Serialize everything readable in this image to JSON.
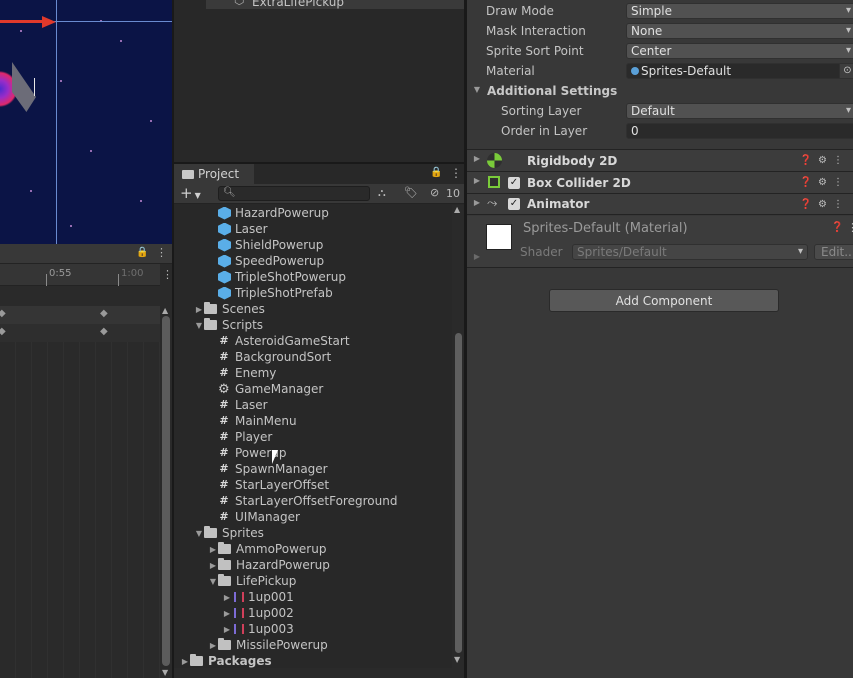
{
  "hierarchy": {
    "item": "ExtraLifePickup"
  },
  "animation": {
    "time_labels": [
      "0:55",
      "1:00"
    ]
  },
  "project": {
    "tab_title": "Project",
    "search": {
      "placeholder": ""
    },
    "hidden_count": "10",
    "items": [
      {
        "label": "HazardPowerup",
        "type": "prefab",
        "indent": 2
      },
      {
        "label": "Laser",
        "type": "prefab",
        "indent": 2
      },
      {
        "label": "ShieldPowerup",
        "type": "prefab",
        "indent": 2
      },
      {
        "label": "SpeedPowerup",
        "type": "prefab",
        "indent": 2
      },
      {
        "label": "TripleShotPowerup",
        "type": "prefab",
        "indent": 2
      },
      {
        "label": "TripleShotPrefab",
        "type": "prefab",
        "indent": 2
      },
      {
        "label": "Scenes",
        "type": "folder",
        "indent": 1,
        "arrow": "collapsed"
      },
      {
        "label": "Scripts",
        "type": "folder",
        "indent": 1,
        "arrow": "expanded"
      },
      {
        "label": "AsteroidGameStart",
        "type": "script",
        "indent": 2
      },
      {
        "label": "BackgroundSort",
        "type": "script",
        "indent": 2
      },
      {
        "label": "Enemy",
        "type": "script",
        "indent": 2
      },
      {
        "label": "GameManager",
        "type": "gear",
        "indent": 2
      },
      {
        "label": "Laser",
        "type": "script",
        "indent": 2
      },
      {
        "label": "MainMenu",
        "type": "script",
        "indent": 2
      },
      {
        "label": "Player",
        "type": "script",
        "indent": 2
      },
      {
        "label": "Powerup",
        "type": "script",
        "indent": 2
      },
      {
        "label": "SpawnManager",
        "type": "script",
        "indent": 2
      },
      {
        "label": "StarLayerOffset",
        "type": "script",
        "indent": 2
      },
      {
        "label": "StarLayerOffsetForeground",
        "type": "script",
        "indent": 2
      },
      {
        "label": "UIManager",
        "type": "script",
        "indent": 2
      },
      {
        "label": "Sprites",
        "type": "folder",
        "indent": 1,
        "arrow": "expanded"
      },
      {
        "label": "AmmoPowerup",
        "type": "folder",
        "indent": 2,
        "arrow": "collapsed"
      },
      {
        "label": "HazardPowerup",
        "type": "folder",
        "indent": 2,
        "arrow": "collapsed"
      },
      {
        "label": "LifePickup",
        "type": "folder",
        "indent": 2,
        "arrow": "expanded"
      },
      {
        "label": "1up001",
        "type": "sprite",
        "indent": 3,
        "arrow": "collapsed"
      },
      {
        "label": "1up002",
        "type": "sprite",
        "indent": 3,
        "arrow": "collapsed"
      },
      {
        "label": "1up003",
        "type": "sprite",
        "indent": 3,
        "arrow": "collapsed"
      },
      {
        "label": "MissilePowerup",
        "type": "folder",
        "indent": 2,
        "arrow": "collapsed"
      },
      {
        "label": "Packages",
        "type": "folder",
        "indent": 0,
        "arrow": "collapsed",
        "bold": true
      }
    ]
  },
  "inspector": {
    "properties": [
      {
        "label": "Draw Mode",
        "value": "Simple",
        "kind": "dropdown"
      },
      {
        "label": "Mask Interaction",
        "value": "None",
        "kind": "dropdown"
      },
      {
        "label": "Sprite Sort Point",
        "value": "Center",
        "kind": "dropdown"
      },
      {
        "label": "Material",
        "value": "Sprites-Default",
        "kind": "object"
      }
    ],
    "additional_settings": {
      "title": "Additional Settings",
      "sorting_layer_label": "Sorting Layer",
      "sorting_layer_value": "Default",
      "order_label": "Order in Layer",
      "order_value": "0"
    },
    "components": [
      {
        "name": "Rigidbody 2D",
        "checkbox": false
      },
      {
        "name": "Box Collider 2D",
        "checkbox": true
      },
      {
        "name": "Animator",
        "checkbox": true
      }
    ],
    "material": {
      "title": "Sprites-Default (Material)",
      "shader_label": "Shader",
      "shader_value": "Sprites/Default",
      "edit_label": "Edit..."
    },
    "add_component_label": "Add Component"
  }
}
